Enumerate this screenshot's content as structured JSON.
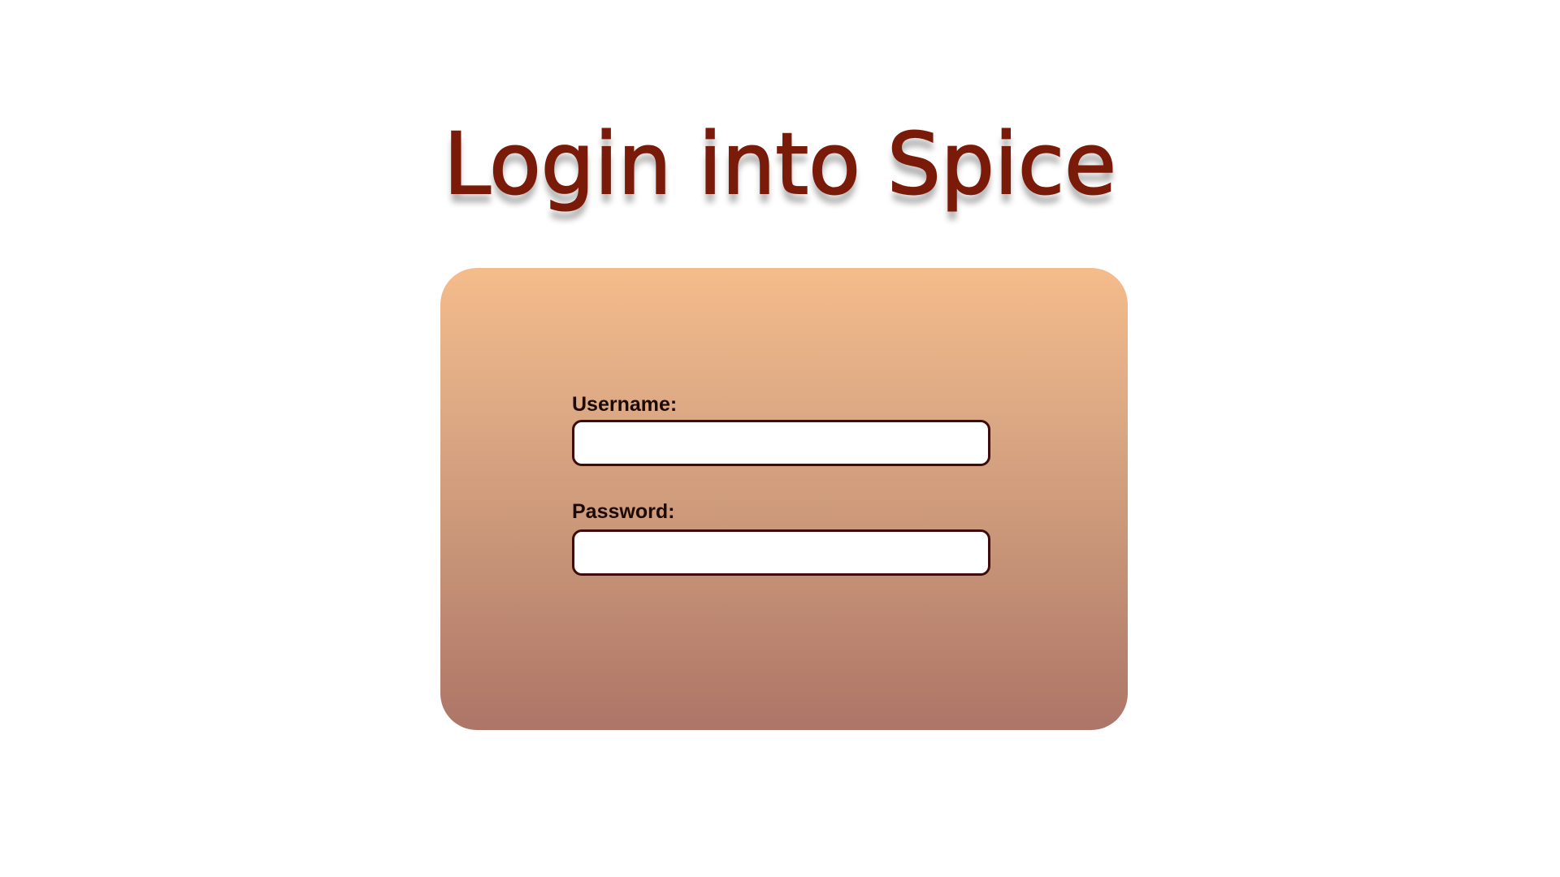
{
  "page": {
    "title": "Login into Spice"
  },
  "login_form": {
    "username": {
      "label": "Username:",
      "value": "",
      "placeholder": ""
    },
    "password": {
      "label": "Password:",
      "value": "",
      "placeholder": ""
    }
  },
  "colors": {
    "title": "#7a1a08",
    "card_gradient_top": "#f5bc8b",
    "card_gradient_bottom": "#ad7567",
    "input_border": "#3f0b0b",
    "label_text": "#1e0a05",
    "page_background": "#ffffff"
  }
}
